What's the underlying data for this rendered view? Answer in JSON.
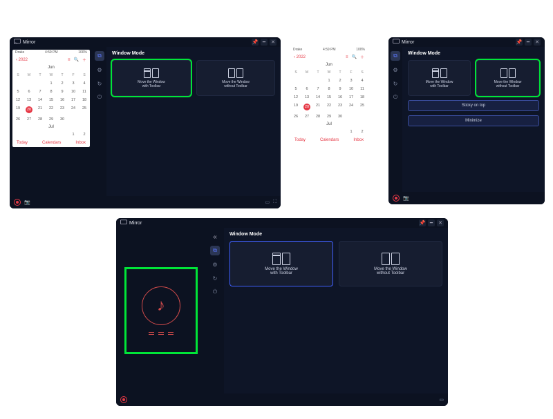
{
  "app_title": "Mirror",
  "section_title": "Window Mode",
  "mode_with": "Move the Window\nwith Toolbar",
  "mode_without": "Move the Window\nwithout Toolbar",
  "btn_sticky": "Sticky on top",
  "btn_minimize": "Minimize",
  "phone": {
    "carrier": "Drake",
    "time": "4:59 PM",
    "year_back": "2022",
    "month1": "Jun",
    "weekdays": [
      "S",
      "M",
      "T",
      "W",
      "T",
      "F",
      "S"
    ],
    "jun_leading_blank": 3,
    "jun_rows": [
      [
        "",
        "",
        "",
        "1",
        "2",
        "3",
        "4"
      ],
      [
        "5",
        "6",
        "7",
        "8",
        "9",
        "10",
        "11"
      ],
      [
        "12",
        "13",
        "14",
        "15",
        "16",
        "17",
        "18"
      ],
      [
        "19",
        "20",
        "21",
        "22",
        "23",
        "24",
        "25"
      ],
      [
        "26",
        "27",
        "28",
        "29",
        "30",
        "",
        ""
      ]
    ],
    "today": "20",
    "month2": "Jul",
    "jul_row": [
      "",
      "",
      "",
      "",
      "",
      "1",
      "2"
    ],
    "bottom_left": "Today",
    "bottom_center": "Calendars",
    "bottom_right": "Inbox"
  }
}
